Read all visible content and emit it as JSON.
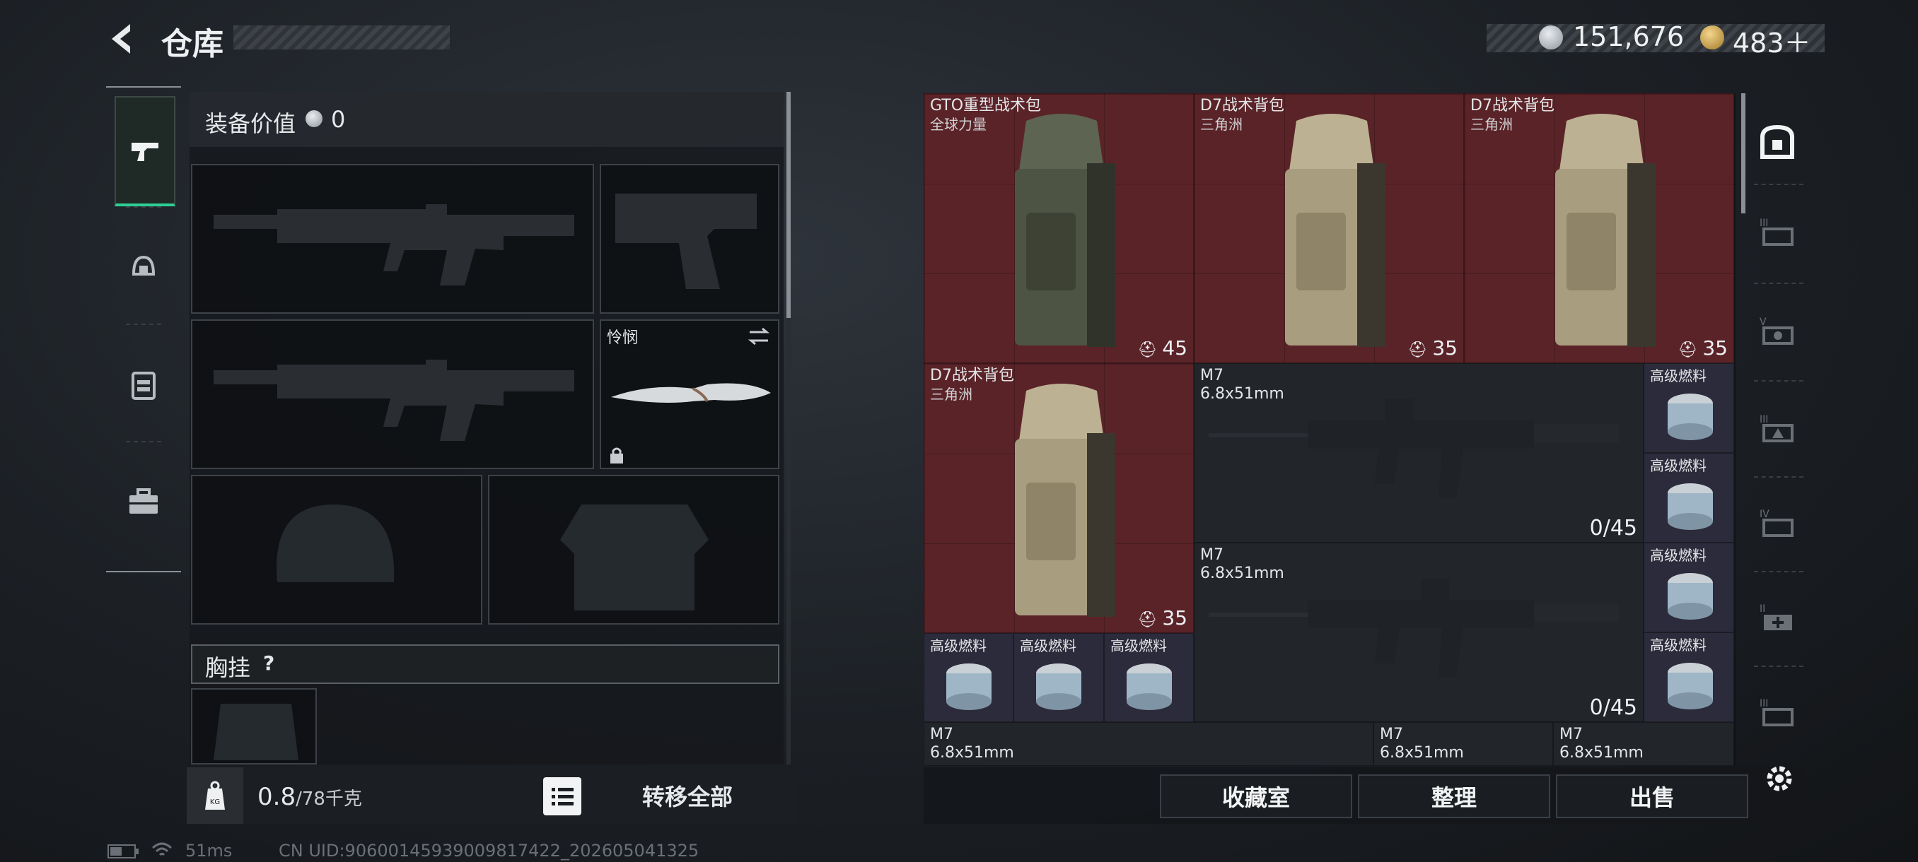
{
  "header": {
    "title": "仓库"
  },
  "currency": {
    "coins": "151,676",
    "premium": "483＋"
  },
  "loadout": {
    "equip_value_label": "装备价值",
    "equip_value": "0",
    "melee_name": "怜悯",
    "chest_label": "胸挂",
    "chest_help": "?"
  },
  "footer_left": {
    "weight": "0.8",
    "weight_cap": "/78千克",
    "transfer_all": "转移全部"
  },
  "stash": {
    "items": [
      {
        "name": "GTO重型战术包",
        "sub": "全球力量",
        "count": "45"
      },
      {
        "name": "D7战术背包",
        "sub": "三角洲",
        "count": "35"
      },
      {
        "name": "D7战术背包",
        "sub": "三角洲",
        "count": "35"
      },
      {
        "name": "D7战术背包",
        "sub": "三角洲",
        "count": "35"
      }
    ],
    "rifles": [
      {
        "name": "M7",
        "caliber": "6.8x51mm",
        "ammo": "0/45"
      },
      {
        "name": "M7",
        "caliber": "6.8x51mm",
        "ammo": "0/45"
      }
    ],
    "fuel_label": "高级燃料",
    "bottom_row": [
      {
        "name": "M7",
        "caliber": "6.8x51mm"
      },
      {
        "name": "M7",
        "caliber": "6.8x51mm"
      },
      {
        "name": "M7",
        "caliber": "6.8x51mm"
      }
    ]
  },
  "actions": {
    "vault": "收藏室",
    "sort": "整理",
    "sell": "出售"
  },
  "status": {
    "ping": "51ms",
    "uid": "CN UID:9060014593900981742​2_202605041325"
  },
  "colors": {
    "accent": "#2ecf95",
    "item_bg_red": "#5a2328",
    "fuel_bg": "#2c2b3b"
  },
  "icons": [
    "back-arrow-icon",
    "silver-coin-icon",
    "gold-coin-icon",
    "pistol-icon",
    "helmet-icon",
    "armor-icon",
    "toolbox-icon",
    "weight-icon",
    "list-icon",
    "swap-icon",
    "lock-icon",
    "safebox-icon",
    "settings-icon"
  ]
}
